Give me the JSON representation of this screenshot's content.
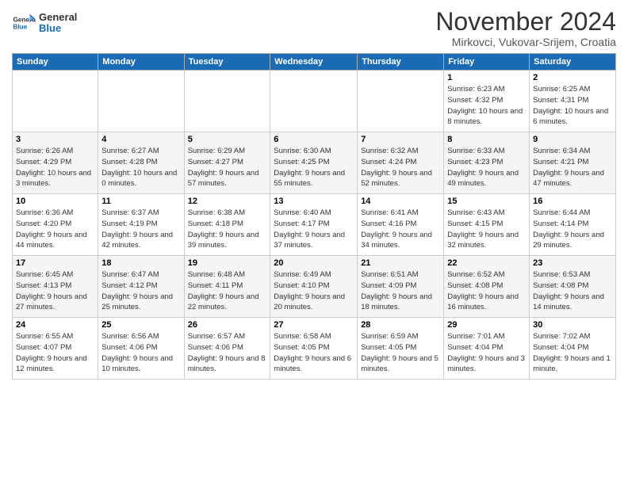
{
  "logo": {
    "general": "General",
    "blue": "Blue"
  },
  "title": "November 2024",
  "location": "Mirkovci, Vukovar-Srijem, Croatia",
  "days_of_week": [
    "Sunday",
    "Monday",
    "Tuesday",
    "Wednesday",
    "Thursday",
    "Friday",
    "Saturday"
  ],
  "weeks": [
    [
      {
        "day": "",
        "info": ""
      },
      {
        "day": "",
        "info": ""
      },
      {
        "day": "",
        "info": ""
      },
      {
        "day": "",
        "info": ""
      },
      {
        "day": "",
        "info": ""
      },
      {
        "day": "1",
        "info": "Sunrise: 6:23 AM\nSunset: 4:32 PM\nDaylight: 10 hours and 8 minutes."
      },
      {
        "day": "2",
        "info": "Sunrise: 6:25 AM\nSunset: 4:31 PM\nDaylight: 10 hours and 6 minutes."
      }
    ],
    [
      {
        "day": "3",
        "info": "Sunrise: 6:26 AM\nSunset: 4:29 PM\nDaylight: 10 hours and 3 minutes."
      },
      {
        "day": "4",
        "info": "Sunrise: 6:27 AM\nSunset: 4:28 PM\nDaylight: 10 hours and 0 minutes."
      },
      {
        "day": "5",
        "info": "Sunrise: 6:29 AM\nSunset: 4:27 PM\nDaylight: 9 hours and 57 minutes."
      },
      {
        "day": "6",
        "info": "Sunrise: 6:30 AM\nSunset: 4:25 PM\nDaylight: 9 hours and 55 minutes."
      },
      {
        "day": "7",
        "info": "Sunrise: 6:32 AM\nSunset: 4:24 PM\nDaylight: 9 hours and 52 minutes."
      },
      {
        "day": "8",
        "info": "Sunrise: 6:33 AM\nSunset: 4:23 PM\nDaylight: 9 hours and 49 minutes."
      },
      {
        "day": "9",
        "info": "Sunrise: 6:34 AM\nSunset: 4:21 PM\nDaylight: 9 hours and 47 minutes."
      }
    ],
    [
      {
        "day": "10",
        "info": "Sunrise: 6:36 AM\nSunset: 4:20 PM\nDaylight: 9 hours and 44 minutes."
      },
      {
        "day": "11",
        "info": "Sunrise: 6:37 AM\nSunset: 4:19 PM\nDaylight: 9 hours and 42 minutes."
      },
      {
        "day": "12",
        "info": "Sunrise: 6:38 AM\nSunset: 4:18 PM\nDaylight: 9 hours and 39 minutes."
      },
      {
        "day": "13",
        "info": "Sunrise: 6:40 AM\nSunset: 4:17 PM\nDaylight: 9 hours and 37 minutes."
      },
      {
        "day": "14",
        "info": "Sunrise: 6:41 AM\nSunset: 4:16 PM\nDaylight: 9 hours and 34 minutes."
      },
      {
        "day": "15",
        "info": "Sunrise: 6:43 AM\nSunset: 4:15 PM\nDaylight: 9 hours and 32 minutes."
      },
      {
        "day": "16",
        "info": "Sunrise: 6:44 AM\nSunset: 4:14 PM\nDaylight: 9 hours and 29 minutes."
      }
    ],
    [
      {
        "day": "17",
        "info": "Sunrise: 6:45 AM\nSunset: 4:13 PM\nDaylight: 9 hours and 27 minutes."
      },
      {
        "day": "18",
        "info": "Sunrise: 6:47 AM\nSunset: 4:12 PM\nDaylight: 9 hours and 25 minutes."
      },
      {
        "day": "19",
        "info": "Sunrise: 6:48 AM\nSunset: 4:11 PM\nDaylight: 9 hours and 22 minutes."
      },
      {
        "day": "20",
        "info": "Sunrise: 6:49 AM\nSunset: 4:10 PM\nDaylight: 9 hours and 20 minutes."
      },
      {
        "day": "21",
        "info": "Sunrise: 6:51 AM\nSunset: 4:09 PM\nDaylight: 9 hours and 18 minutes."
      },
      {
        "day": "22",
        "info": "Sunrise: 6:52 AM\nSunset: 4:08 PM\nDaylight: 9 hours and 16 minutes."
      },
      {
        "day": "23",
        "info": "Sunrise: 6:53 AM\nSunset: 4:08 PM\nDaylight: 9 hours and 14 minutes."
      }
    ],
    [
      {
        "day": "24",
        "info": "Sunrise: 6:55 AM\nSunset: 4:07 PM\nDaylight: 9 hours and 12 minutes."
      },
      {
        "day": "25",
        "info": "Sunrise: 6:56 AM\nSunset: 4:06 PM\nDaylight: 9 hours and 10 minutes."
      },
      {
        "day": "26",
        "info": "Sunrise: 6:57 AM\nSunset: 4:06 PM\nDaylight: 9 hours and 8 minutes."
      },
      {
        "day": "27",
        "info": "Sunrise: 6:58 AM\nSunset: 4:05 PM\nDaylight: 9 hours and 6 minutes."
      },
      {
        "day": "28",
        "info": "Sunrise: 6:59 AM\nSunset: 4:05 PM\nDaylight: 9 hours and 5 minutes."
      },
      {
        "day": "29",
        "info": "Sunrise: 7:01 AM\nSunset: 4:04 PM\nDaylight: 9 hours and 3 minutes."
      },
      {
        "day": "30",
        "info": "Sunrise: 7:02 AM\nSunset: 4:04 PM\nDaylight: 9 hours and 1 minute."
      }
    ]
  ]
}
